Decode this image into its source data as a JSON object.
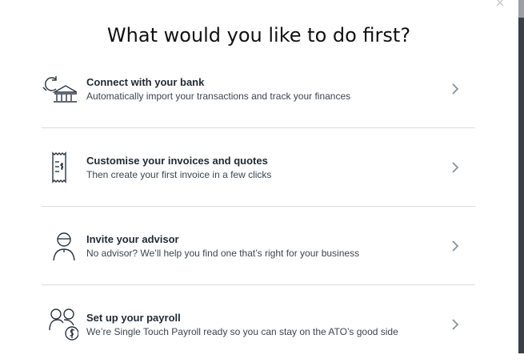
{
  "dialog": {
    "close_glyph": "×",
    "title": "What would you like to do first?"
  },
  "options": [
    {
      "icon": "bank-sync-icon",
      "title": "Connect with your bank",
      "description": "Automatically import your transactions and track your finances"
    },
    {
      "icon": "invoice-icon",
      "title": "Customise your invoices and quotes",
      "description": "Then create your first invoice in a few clicks"
    },
    {
      "icon": "advisor-icon",
      "title": "Invite your advisor",
      "description": "No advisor? We’ll help you find one that’s right for your business"
    },
    {
      "icon": "payroll-icon",
      "title": "Set up your payroll",
      "description": "We’re Single Touch Payroll ready so you can stay on the ATO’s good side"
    }
  ],
  "colors": {
    "divider": "#d9dcdf",
    "icon_stroke": "#2b3540",
    "chevron": "#8a9299"
  }
}
